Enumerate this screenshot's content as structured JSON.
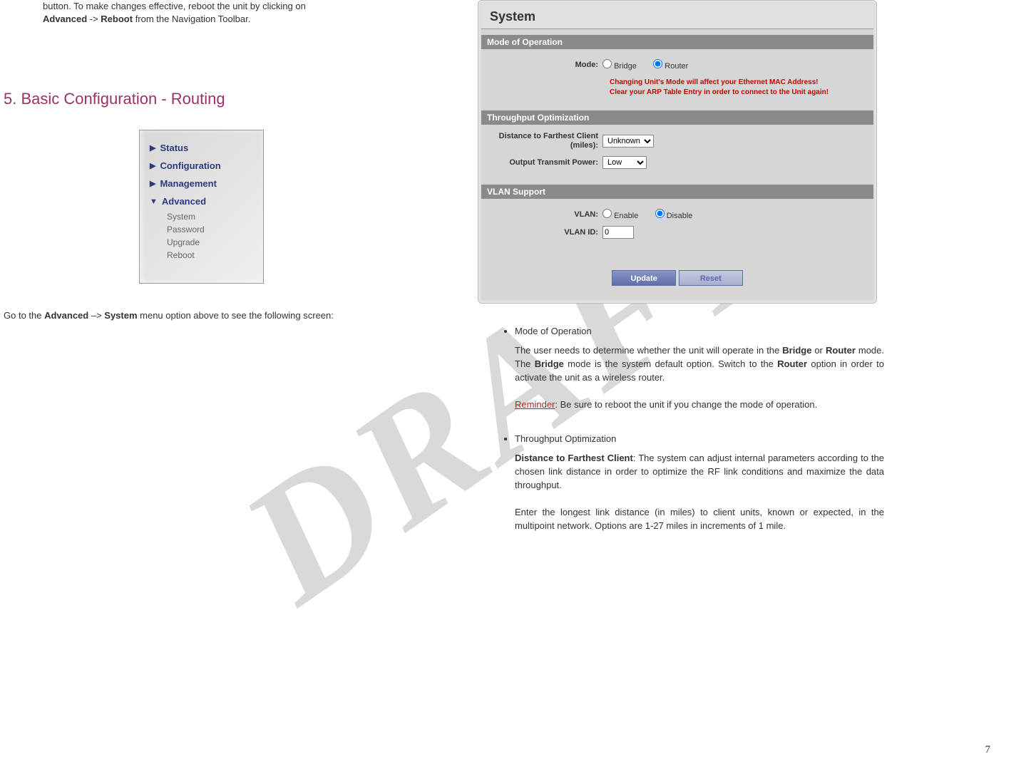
{
  "watermark": "DRAFT",
  "top_fragment": {
    "line1_part1": "button.   To  make  changes  effective,  reboot  the  unit  by  clicking  on",
    "line2_bold1": "Advanced",
    "line2_arrow": " -> ",
    "line2_bold2": "Reboot",
    "line2_rest": " from the Navigation Toolbar."
  },
  "section_heading": "5. Basic Configuration - Routing",
  "nav": {
    "status": "Status",
    "configuration": "Configuration",
    "management": "Management",
    "advanced": "Advanced",
    "subs": [
      "System",
      "Password",
      "Upgrade",
      "Reboot"
    ]
  },
  "below_nav": {
    "text1": "Go to the ",
    "bold1": "Advanced",
    "text2": " –> ",
    "bold2": "System",
    "text3": " menu option above to see the following screen:"
  },
  "system_panel": {
    "title": "System",
    "mode_header": "Mode of Operation",
    "mode_label": "Mode:",
    "mode_options": {
      "bridge": "Bridge",
      "router": "Router"
    },
    "mode_selected": "Router",
    "warning_line1": "Changing Unit's Mode will affect your Ethernet MAC Address!",
    "warning_line2": "Clear your ARP Table Entry in order to connect to the Unit again!",
    "throughput_header": "Throughput Optimization",
    "distance_label": "Distance to Farthest Client (miles):",
    "distance_value": "Unknown",
    "power_label": "Output Transmit Power:",
    "power_value": "Low",
    "vlan_header": "VLAN Support",
    "vlan_label": "VLAN:",
    "vlan_options": {
      "enable": "Enable",
      "disable": "Disable"
    },
    "vlan_selected": "Disable",
    "vlan_id_label": "VLAN ID:",
    "vlan_id_value": "0",
    "btn_update": "Update",
    "btn_reset": "Reset"
  },
  "right_text": {
    "bullet1": "Mode of Operation",
    "para1a": "The  user  needs  to  determine  whether  the  unit  will  operate  in  the ",
    "para1_bridge": "Bridge",
    "para1b": "  or  ",
    "para1_router": "Router",
    "para1c": "  mode.  The  ",
    "para1_bridge2": "Bridge",
    "para1d": "  mode  is  the  system  default option.  Switch  to  the  ",
    "para1_router2": "Router",
    "para1e": "  option  in  order  to  activate  the  unit  as  a wireless router.",
    "reminder_label": "Reminder",
    "reminder_text": ":  Be  sure  to  reboot  the  unit  if  you  change  the  mode  of operation.",
    "bullet2": "Throughput Optimization",
    "para2_bold": "Distance   to   Farthest   Client",
    "para2_rest1": ":   The   system   can   adjust   internal parameters  according  to  the  chosen  link  distance  in  order  to  optimize the RF link conditions and maximize the data throughput.",
    "para2b": "Enter  the  longest  link  distance  (in  miles)  to  client  units,  known  or expected,   in   the   multipoint   network.   Options   are   1-27   miles   in increments of 1 mile."
  },
  "page_number": "7"
}
